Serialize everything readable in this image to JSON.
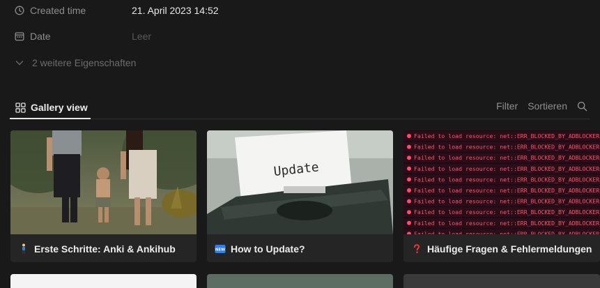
{
  "properties": {
    "created": {
      "label": "Created time",
      "value": "21. April 2023 14:52",
      "icon": "clock-icon"
    },
    "date": {
      "label": "Date",
      "value": "Leer",
      "icon": "calendar-icon"
    },
    "more": "2 weitere Eigenschaften"
  },
  "view": {
    "tab_label": "Gallery view",
    "filter_label": "Filter",
    "sort_label": "Sortieren"
  },
  "cards": [
    {
      "title": "Erste Schritte: Anki & Ankihub",
      "emoji": "person-walking-icon"
    },
    {
      "title": "How to Update?",
      "emoji": "new-badge-icon",
      "cover_text": "Update"
    },
    {
      "title": "Häufige Fragen & Fehlermeldungen",
      "emoji": "red-question-mark-icon",
      "cover_text": "Failed to load resource: net::ERR_BLOCKED_BY_ADBLOCKER"
    }
  ],
  "colors": {
    "background": "#191919",
    "card": "#252525",
    "muted": "#8e8e8e",
    "error_red": "#ff4f6d"
  }
}
